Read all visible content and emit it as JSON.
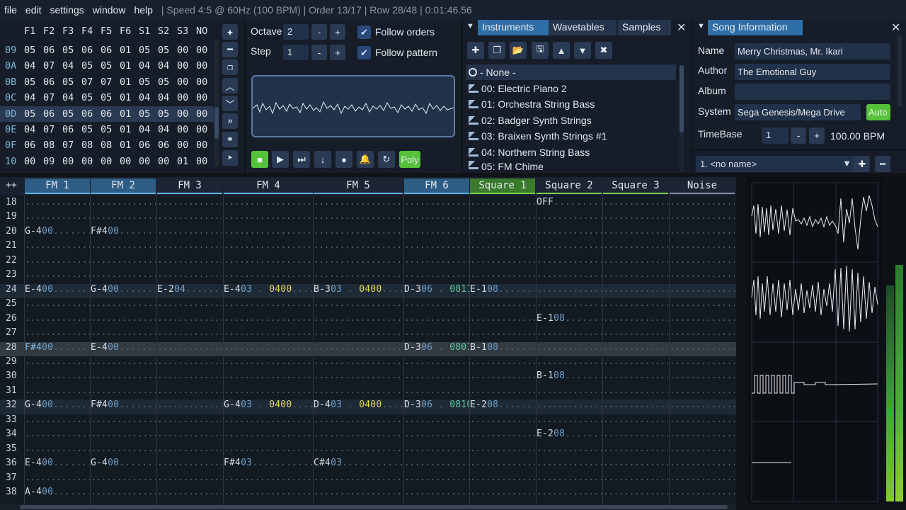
{
  "menu": [
    "file",
    "edit",
    "settings",
    "window",
    "help"
  ],
  "status": "| Speed 4:5 @ 60Hz (100 BPM) | Order 13/17 | Row 28/48 | 0:01:46.56",
  "orders": {
    "headers": [
      "F1",
      "F2",
      "F3",
      "F4",
      "F5",
      "F6",
      "S1",
      "S2",
      "S3",
      "NO"
    ],
    "rows": [
      {
        "n": "09",
        "v": [
          "05",
          "06",
          "05",
          "06",
          "06",
          "01",
          "05",
          "05",
          "00",
          "00"
        ]
      },
      {
        "n": "0A",
        "v": [
          "04",
          "07",
          "04",
          "05",
          "05",
          "01",
          "04",
          "04",
          "00",
          "00"
        ]
      },
      {
        "n": "0B",
        "v": [
          "05",
          "06",
          "05",
          "07",
          "07",
          "01",
          "05",
          "05",
          "00",
          "00"
        ]
      },
      {
        "n": "0C",
        "v": [
          "04",
          "07",
          "04",
          "05",
          "05",
          "01",
          "04",
          "04",
          "00",
          "00"
        ]
      },
      {
        "n": "0D",
        "v": [
          "05",
          "06",
          "05",
          "06",
          "06",
          "01",
          "05",
          "05",
          "00",
          "00"
        ]
      },
      {
        "n": "0E",
        "v": [
          "04",
          "07",
          "06",
          "05",
          "05",
          "01",
          "04",
          "04",
          "00",
          "00"
        ]
      },
      {
        "n": "0F",
        "v": [
          "06",
          "08",
          "07",
          "08",
          "08",
          "01",
          "06",
          "06",
          "00",
          "00"
        ]
      },
      {
        "n": "10",
        "v": [
          "00",
          "09",
          "00",
          "00",
          "00",
          "00",
          "00",
          "00",
          "01",
          "00"
        ]
      }
    ]
  },
  "octave": {
    "octave_label": "Octave",
    "octave_value": "2",
    "step_label": "Step",
    "step_value": "1",
    "follow_orders": "Follow orders",
    "follow_pattern": "Follow pattern",
    "poly": "Poly"
  },
  "instruments": {
    "tabs": [
      "Instruments",
      "Wavetables",
      "Samples"
    ],
    "items": [
      "- None -",
      "00: Electric Piano 2",
      "01: Orchestra String Bass",
      "02: Badger Synth Strings",
      "03: Braixen Synth Strings #1",
      "04: Northern String Bass",
      "05: FM Chime"
    ]
  },
  "song": {
    "tab": "Song Information",
    "name_label": "Name",
    "name": "Merry Christmas, Mr. Ikari",
    "author_label": "Author",
    "author": "The Emotional Guy",
    "album_label": "Album",
    "album": "",
    "system_label": "System",
    "system": "Sega Genesis/Mega Drive",
    "auto": "Auto",
    "timebase_label": "TimeBase",
    "timebase": "1",
    "bpm": "100.00 BPM",
    "subsong": "1. <no name>"
  },
  "pattern": {
    "channels": [
      "FM 1",
      "FM 2",
      "FM 3",
      "FM 4",
      "FM 5",
      "FM 6",
      "Square 1",
      "Square 2",
      "Square 3",
      "Noise"
    ],
    "rows": [
      "18",
      "19",
      "20",
      "21",
      "22",
      "23",
      "24",
      "25",
      "26",
      "27",
      "28",
      "29",
      "30",
      "31",
      "32",
      "33",
      "34",
      "35",
      "36",
      "37",
      "38"
    ]
  },
  "colors": {
    "accent": "#2f6fa8",
    "green": "#57c23a"
  }
}
